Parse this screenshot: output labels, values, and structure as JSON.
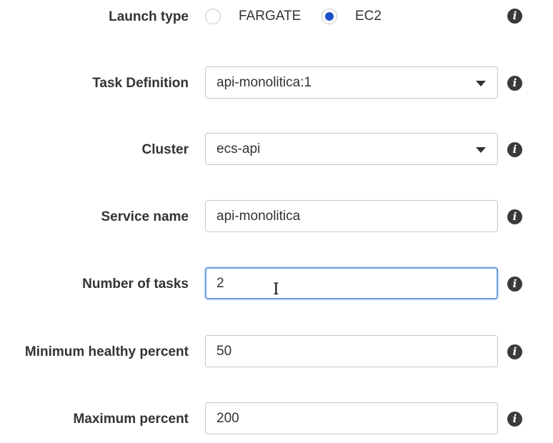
{
  "form": {
    "launch_type": {
      "label": "Launch type",
      "options": [
        "FARGATE",
        "EC2"
      ],
      "selected": "EC2",
      "accent_color": "#2150c8"
    },
    "task_definition": {
      "label": "Task Definition",
      "value": "api-monolitica:1"
    },
    "cluster": {
      "label": "Cluster",
      "value": "ecs-api"
    },
    "service_name": {
      "label": "Service name",
      "value": "api-monolitica"
    },
    "number_of_tasks": {
      "label": "Number of tasks",
      "value": "2"
    },
    "min_healthy_percent": {
      "label": "Minimum healthy percent",
      "value": "50"
    },
    "max_percent": {
      "label": "Maximum percent",
      "value": "200"
    }
  },
  "icons": {
    "info": "info-icon",
    "dropdown": "caret-down-icon",
    "cursor": "text-cursor-icon"
  }
}
